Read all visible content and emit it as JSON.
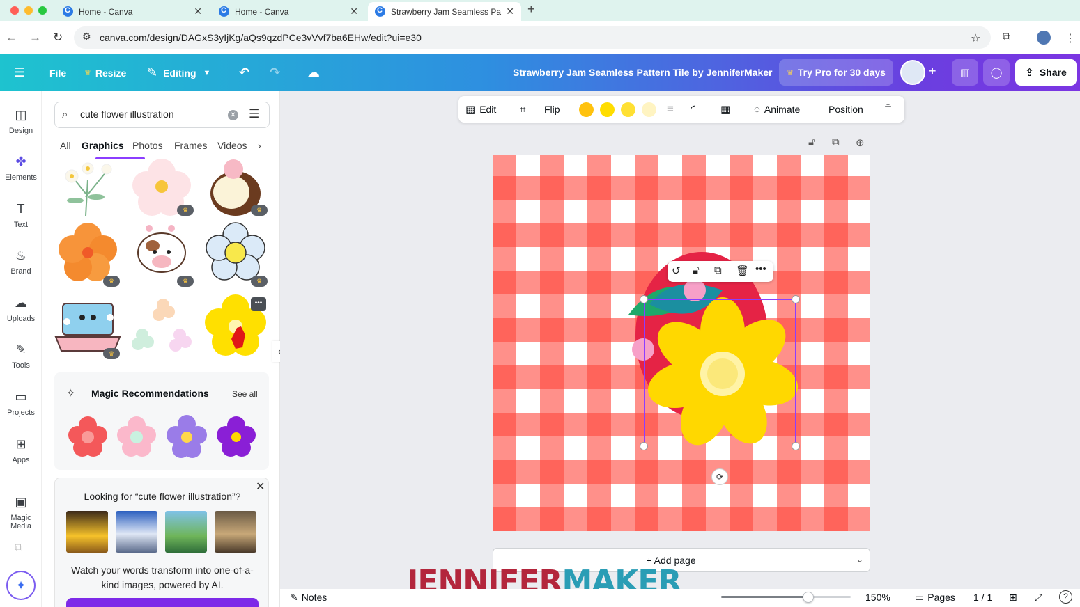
{
  "browser": {
    "tabs": [
      {
        "label": "Home - Canva"
      },
      {
        "label": "Home - Canva"
      },
      {
        "label": "Strawberry Jam Seamless Pa"
      }
    ],
    "url": "canva.com/design/DAGxS3yIjKg/aQs9qzdPCe3vVvf7ba6EHw/edit?ui=e30"
  },
  "topbar": {
    "file": "File",
    "resize": "Resize",
    "editing": "Editing",
    "doc_title": "Strawberry Jam Seamless Pattern Tile by JenniferMaker",
    "try_pro": "Try Pro for 30 days",
    "share": "Share"
  },
  "rail": {
    "items": [
      {
        "label": "Design",
        "icon": "design-icon"
      },
      {
        "label": "Elements",
        "icon": "elements-icon"
      },
      {
        "label": "Text",
        "icon": "text-icon"
      },
      {
        "label": "Brand",
        "icon": "brand-icon"
      },
      {
        "label": "Uploads",
        "icon": "uploads-icon"
      },
      {
        "label": "Tools",
        "icon": "tools-icon"
      },
      {
        "label": "Projects",
        "icon": "projects-icon"
      },
      {
        "label": "Apps",
        "icon": "apps-icon"
      },
      {
        "label": "Magic Media",
        "icon": "magic-media-icon"
      }
    ]
  },
  "panel": {
    "search_value": "cute flower illustration",
    "categories": [
      "All",
      "Graphics",
      "Photos",
      "Frames",
      "Videos"
    ],
    "active_category": "Graphics",
    "magic_title": "Magic Recommendations",
    "see_all": "See all",
    "looking_title": "Looking for “cute flower illustration”?",
    "looking_desc": "Watch your words transform into one-of-a-kind images, powered by AI."
  },
  "toolbar": {
    "edit": "Edit",
    "flip": "Flip",
    "animate": "Animate",
    "position": "Position",
    "swatches": [
      "#ffc20e",
      "#ffdd00",
      "#ffe033",
      "#fff4c2"
    ]
  },
  "canvas": {
    "add_page": "+ Add page",
    "watermark_a": "JENNIFER",
    "watermark_b": "MAKER",
    "pattern_color": "#ff463c"
  },
  "bottombar": {
    "notes": "Notes",
    "zoom": "150%",
    "zoom_fraction": 0.67,
    "pages": "Pages",
    "page_count": "1 / 1"
  }
}
